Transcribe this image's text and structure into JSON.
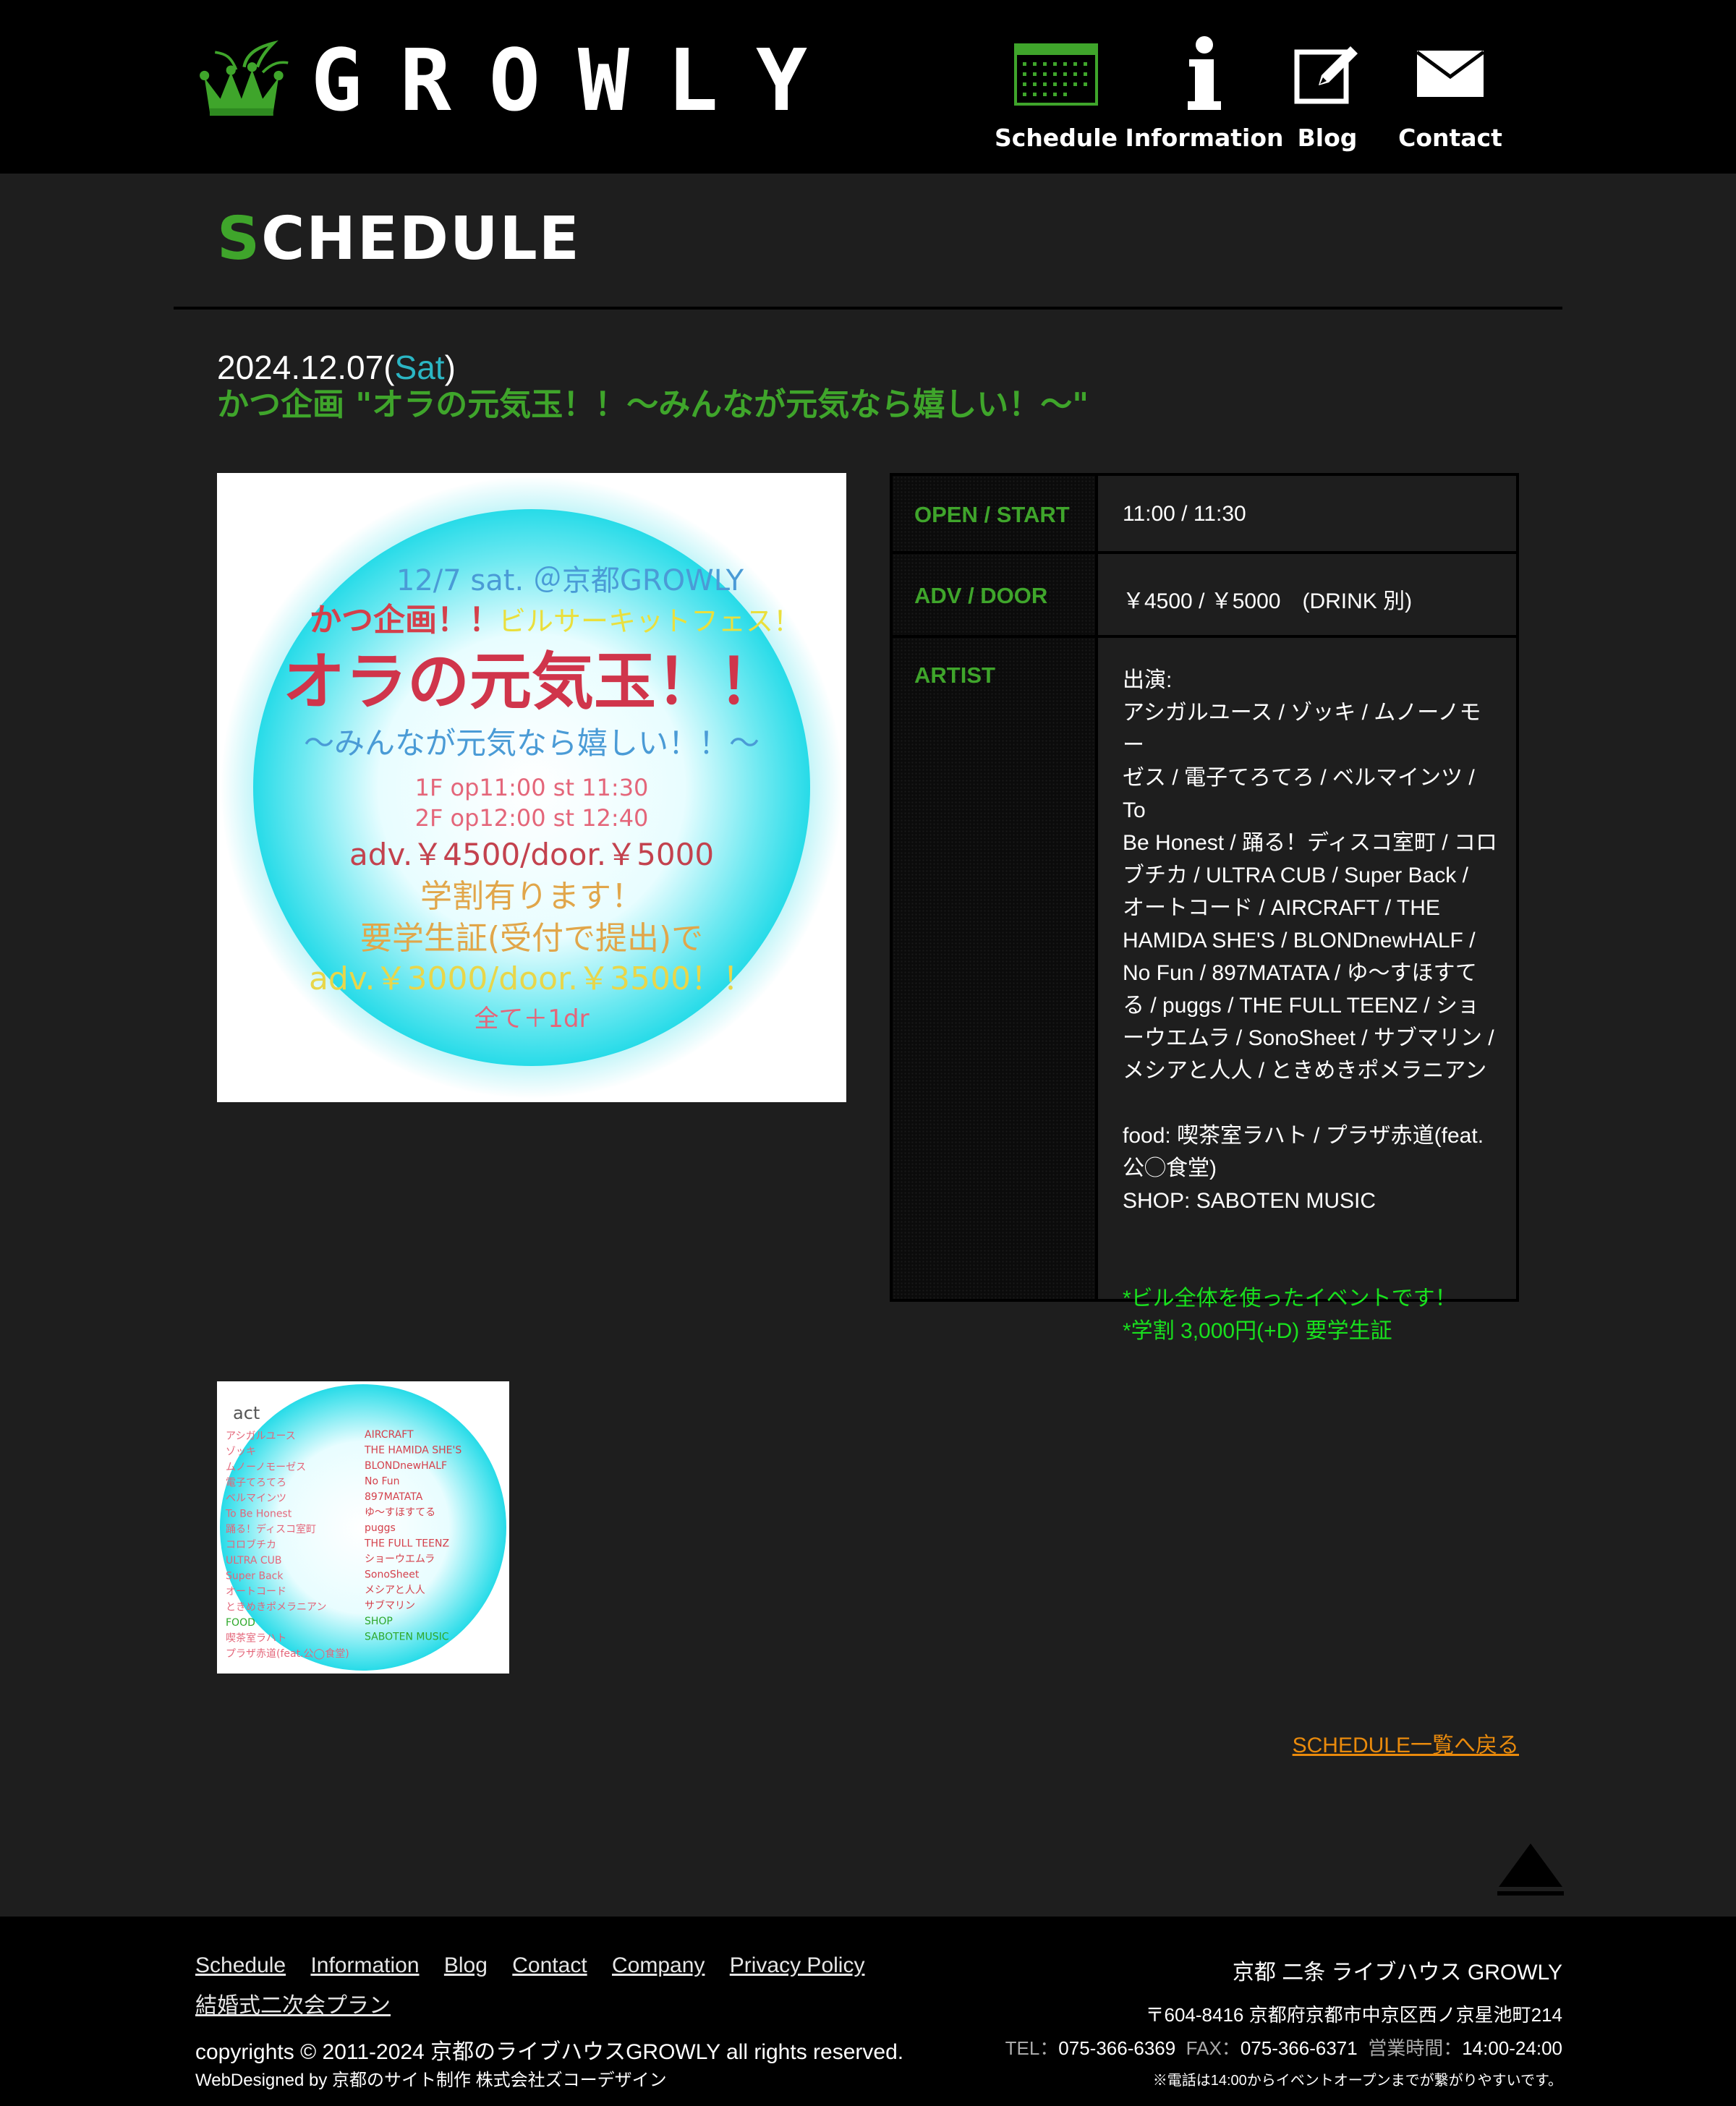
{
  "header": {
    "logo_text": "GROWLY",
    "nav": [
      {
        "label": "Schedule",
        "icon": "calendar-icon"
      },
      {
        "label": "Information",
        "icon": "info-icon"
      },
      {
        "label": "Blog",
        "icon": "edit-icon"
      },
      {
        "label": "Contact",
        "icon": "mail-icon"
      }
    ]
  },
  "page": {
    "title_first": "S",
    "title_rest": "CHEDULE"
  },
  "event": {
    "date": "2024.12.07(",
    "weekday": "Sat",
    "date_close": ")",
    "title": "かつ企画 \"オラの元気玉！！〜みんなが元気なら嬉しい！〜\""
  },
  "flyer": {
    "line1": "12/7 sat. ＠京都GROWLY",
    "line2a": "かつ企画！！",
    "line2b": "ビルサーキットフェス！",
    "line3": "オラの元気玉！！",
    "line4": "〜みんなが元気なら嬉しい！！〜",
    "line5": "1F op11:00 st 11:30",
    "line6": "2F op12:00 st 12:40",
    "line7": "adv.￥4500/door.￥5000",
    "line8": "学割有ります！",
    "line9": "要学生証(受付で提出)で",
    "line10": "adv.￥3000/door.￥3500！！",
    "line11": "全て＋1dr"
  },
  "info": {
    "open_label": "OPEN / START",
    "open_value": "11:00 / 11:30",
    "adv_label": "ADV / DOOR",
    "adv_value": "￥4500 / ￥5000　(DRINK 別)",
    "artist_label": "ARTIST",
    "artist_value": "出演:\nアシガルユース / ゾッキ / ムノーノモー\nゼス / 電子てろてろ / ベルマインツ / To\nBe Honest / 踊る！ディスコ室町 / コロ\nブチカ / ULTRA CUB / Super Back /\nオートコード / AIRCRAFT / THE\nHAMIDA SHE'S / BLONDnewHALF /\nNo Fun / 897MATATA / ゆ〜すほすて\nる / puggs / THE FULL TEENZ / ショ\nーウエムラ / SonoSheet / サブマリン /\nメシアと人人 / ときめきポメラニアン\n\nfood: 喫茶室ラハト / プラザ赤道(feat.\n公◯食堂)\nSHOP: SABOTEN MUSIC",
    "note1": "*ビル全体を使ったイベントです！",
    "note2": "*学割 3,000円(+D) 要学生証"
  },
  "thumb": {
    "act": "act",
    "left_col": [
      "アシガルユース",
      "ゾッキ",
      "ムノーノモーゼス",
      "電子てろてろ",
      "ベルマインツ",
      "To Be Honest",
      "踊る！ディスコ室町",
      "コロブチカ",
      "ULTRA CUB",
      "Super Back",
      "オートコード",
      "ときめきポメラニアン",
      "FOOD",
      "喫茶室ラハト",
      "プラザ赤道(feat.公◯食堂)"
    ],
    "right_col": [
      "AIRCRAFT",
      "THE HAMIDA SHE'S",
      "BLONDnewHALF",
      "No Fun",
      "897MATATA",
      "ゆ〜すほすてる",
      "puggs",
      "THE FULL TEENZ",
      "ショーウエムラ",
      "SonoSheet",
      "メシアと人人",
      "サブマリン",
      "SHOP",
      "SABOTEN MUSIC"
    ]
  },
  "back_link": "SCHEDULE一覧へ戻る",
  "footer": {
    "links": [
      "Schedule",
      "Information",
      "Blog",
      "Contact",
      "Company",
      "Privacy Policy",
      "結婚式二次会プラン"
    ],
    "copyright": "copyrights © 2011-2024 京都のライブハウスGROWLY all rights reserved.",
    "webdesign": "WebDesigned by 京都のサイト制作 株式会社ズコーデザイン",
    "venue_name": "京都 二条 ライブハウス GROWLY",
    "address": "〒604-8416 京都府京都市中京区西ノ京星池町214",
    "tel_label": "TEL：",
    "tel": "075-366-6369",
    "fax_label": "FAX：",
    "fax": "075-366-6371",
    "hours_label": "営業時間：",
    "hours": "14:00-24:00",
    "phone_note": "※電話は14:00からイベントオープンまでが繋がりやすいです。"
  },
  "colors": {
    "accent_green": "#3fa52b",
    "note_green": "#19e11e",
    "weekday_teal": "#2bb6c4",
    "link_orange": "#e98a0c",
    "background": "#1e1e1e"
  }
}
